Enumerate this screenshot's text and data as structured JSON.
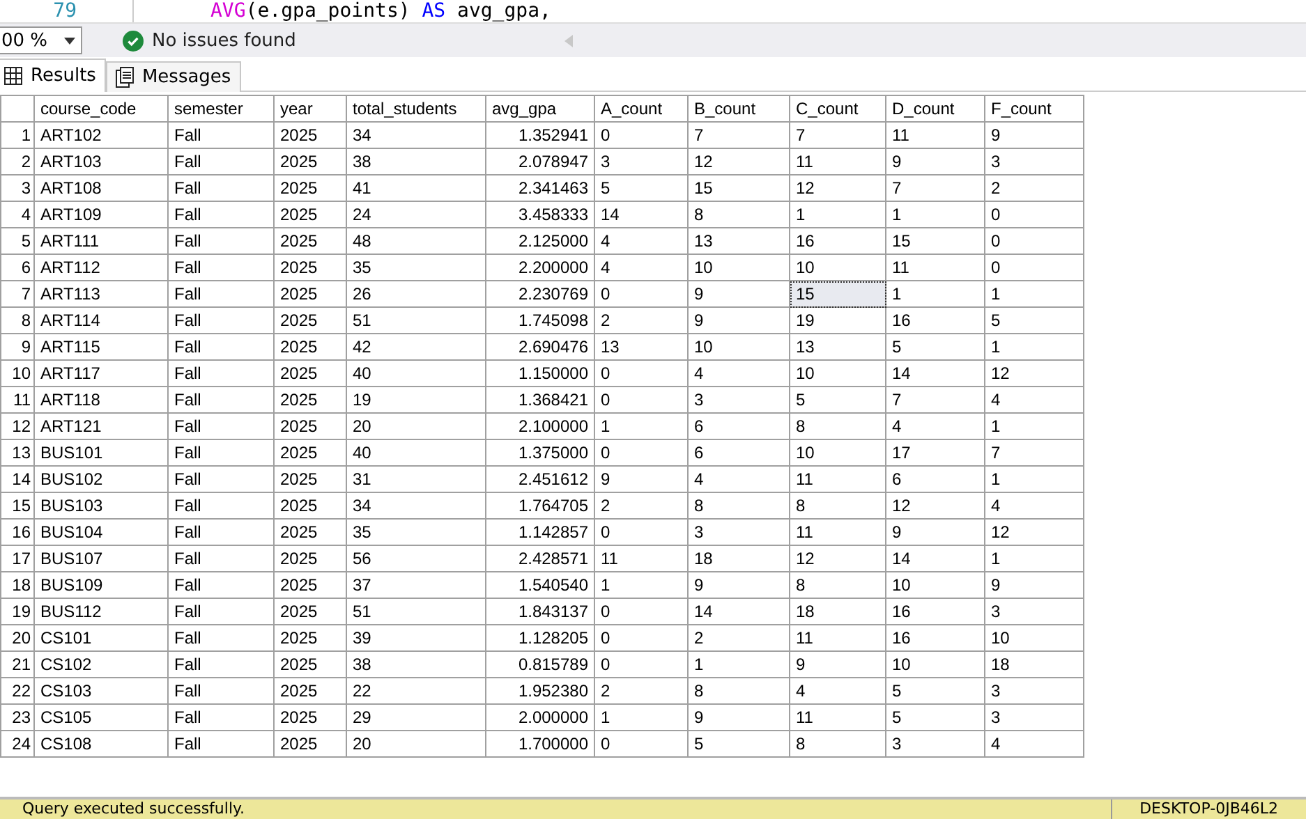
{
  "editor": {
    "line_number": "79",
    "code": [
      {
        "kind": "function",
        "text": "AVG"
      },
      {
        "kind": "plain",
        "text": "(e.gpa_points) "
      },
      {
        "kind": "keyword",
        "text": "AS"
      },
      {
        "kind": "plain",
        "text": " avg_gpa,"
      }
    ]
  },
  "toolbar": {
    "zoom": "00 %",
    "status": "No issues found"
  },
  "tabs": [
    {
      "label": "Results",
      "selected": true
    },
    {
      "label": "Messages",
      "selected": false
    }
  ],
  "grid": {
    "columns": [
      "course_code",
      "semester",
      "year",
      "total_students",
      "avg_gpa",
      "A_count",
      "B_count",
      "C_count",
      "D_count",
      "F_count"
    ],
    "rows": [
      {
        "number": "1",
        "cells": [
          "ART102",
          "Fall",
          "2025",
          "34",
          "1.352941",
          "0",
          "7",
          "7",
          "11",
          "9"
        ]
      },
      {
        "number": "2",
        "cells": [
          "ART103",
          "Fall",
          "2025",
          "38",
          "2.078947",
          "3",
          "12",
          "11",
          "9",
          "3"
        ]
      },
      {
        "number": "3",
        "cells": [
          "ART108",
          "Fall",
          "2025",
          "41",
          "2.341463",
          "5",
          "15",
          "12",
          "7",
          "2"
        ]
      },
      {
        "number": "4",
        "cells": [
          "ART109",
          "Fall",
          "2025",
          "24",
          "3.458333",
          "14",
          "8",
          "1",
          "1",
          "0"
        ]
      },
      {
        "number": "5",
        "cells": [
          "ART111",
          "Fall",
          "2025",
          "48",
          "2.125000",
          "4",
          "13",
          "16",
          "15",
          "0"
        ]
      },
      {
        "number": "6",
        "cells": [
          "ART112",
          "Fall",
          "2025",
          "35",
          "2.200000",
          "4",
          "10",
          "10",
          "11",
          "0"
        ]
      },
      {
        "number": "7",
        "cells": [
          "ART113",
          "Fall",
          "2025",
          "26",
          "2.230769",
          "0",
          "9",
          {
            "text": "15",
            "selected": true
          },
          "1",
          "1"
        ]
      },
      {
        "number": "8",
        "cells": [
          "ART114",
          "Fall",
          "2025",
          "51",
          "1.745098",
          "2",
          "9",
          "19",
          "16",
          "5"
        ]
      },
      {
        "number": "9",
        "cells": [
          "ART115",
          "Fall",
          "2025",
          "42",
          "2.690476",
          "13",
          "10",
          "13",
          "5",
          "1"
        ]
      },
      {
        "number": "10",
        "cells": [
          "ART117",
          "Fall",
          "2025",
          "40",
          "1.150000",
          "0",
          "4",
          "10",
          "14",
          "12"
        ]
      },
      {
        "number": "11",
        "cells": [
          "ART118",
          "Fall",
          "2025",
          "19",
          "1.368421",
          "0",
          "3",
          "5",
          "7",
          "4"
        ]
      },
      {
        "number": "12",
        "cells": [
          "ART121",
          "Fall",
          "2025",
          "20",
          "2.100000",
          "1",
          "6",
          "8",
          "4",
          "1"
        ]
      },
      {
        "number": "13",
        "cells": [
          "BUS101",
          "Fall",
          "2025",
          "40",
          "1.375000",
          "0",
          "6",
          "10",
          "17",
          "7"
        ]
      },
      {
        "number": "14",
        "cells": [
          "BUS102",
          "Fall",
          "2025",
          "31",
          "2.451612",
          "9",
          "4",
          "11",
          "6",
          "1"
        ]
      },
      {
        "number": "15",
        "cells": [
          "BUS103",
          "Fall",
          "2025",
          "34",
          "1.764705",
          "2",
          "8",
          "8",
          "12",
          "4"
        ]
      },
      {
        "number": "16",
        "cells": [
          "BUS104",
          "Fall",
          "2025",
          "35",
          "1.142857",
          "0",
          "3",
          "11",
          "9",
          "12"
        ]
      },
      {
        "number": "17",
        "cells": [
          "BUS107",
          "Fall",
          "2025",
          "56",
          "2.428571",
          "11",
          "18",
          "12",
          "14",
          "1"
        ]
      },
      {
        "number": "18",
        "cells": [
          "BUS109",
          "Fall",
          "2025",
          "37",
          "1.540540",
          "1",
          "9",
          "8",
          "10",
          "9"
        ]
      },
      {
        "number": "19",
        "cells": [
          "BUS112",
          "Fall",
          "2025",
          "51",
          "1.843137",
          "0",
          "14",
          "18",
          "16",
          "3"
        ]
      },
      {
        "number": "20",
        "cells": [
          "CS101",
          "Fall",
          "2025",
          "39",
          "1.128205",
          "0",
          "2",
          "11",
          "16",
          "10"
        ]
      },
      {
        "number": "21",
        "cells": [
          "CS102",
          "Fall",
          "2025",
          "38",
          "0.815789",
          "0",
          "1",
          "9",
          "10",
          "18"
        ]
      },
      {
        "number": "22",
        "cells": [
          "CS103",
          "Fall",
          "2025",
          "22",
          "1.952380",
          "2",
          "8",
          "4",
          "5",
          "3"
        ]
      },
      {
        "number": "23",
        "cells": [
          "CS105",
          "Fall",
          "2025",
          "29",
          "2.000000",
          "1",
          "9",
          "11",
          "5",
          "3"
        ]
      },
      {
        "number": "24",
        "cells": [
          "CS108",
          "Fall",
          "2025",
          "20",
          "1.700000",
          "0",
          "5",
          "8",
          "3",
          "4"
        ]
      }
    ]
  },
  "status_bar": {
    "message": "Query executed successfully.",
    "server": "DESKTOP-0JB46L2"
  }
}
